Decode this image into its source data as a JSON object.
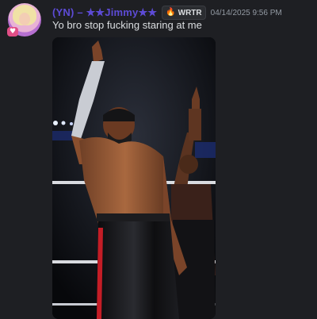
{
  "message": {
    "username": "(YN) – ★★Jimmy★★",
    "server_tag": {
      "icon": "flame-icon",
      "label": "WRTR"
    },
    "timestamp": "04/14/2025 9:56 PM",
    "content": "Yo bro stop fucking staring at me",
    "attachment": {
      "type": "image",
      "subject": "wrestler-photo"
    }
  },
  "colors": {
    "background": "#1e1f23",
    "username": "#5d4bd6",
    "text": "#dbdee1",
    "muted": "#949ba4",
    "tag_bg": "#2b2d31"
  }
}
